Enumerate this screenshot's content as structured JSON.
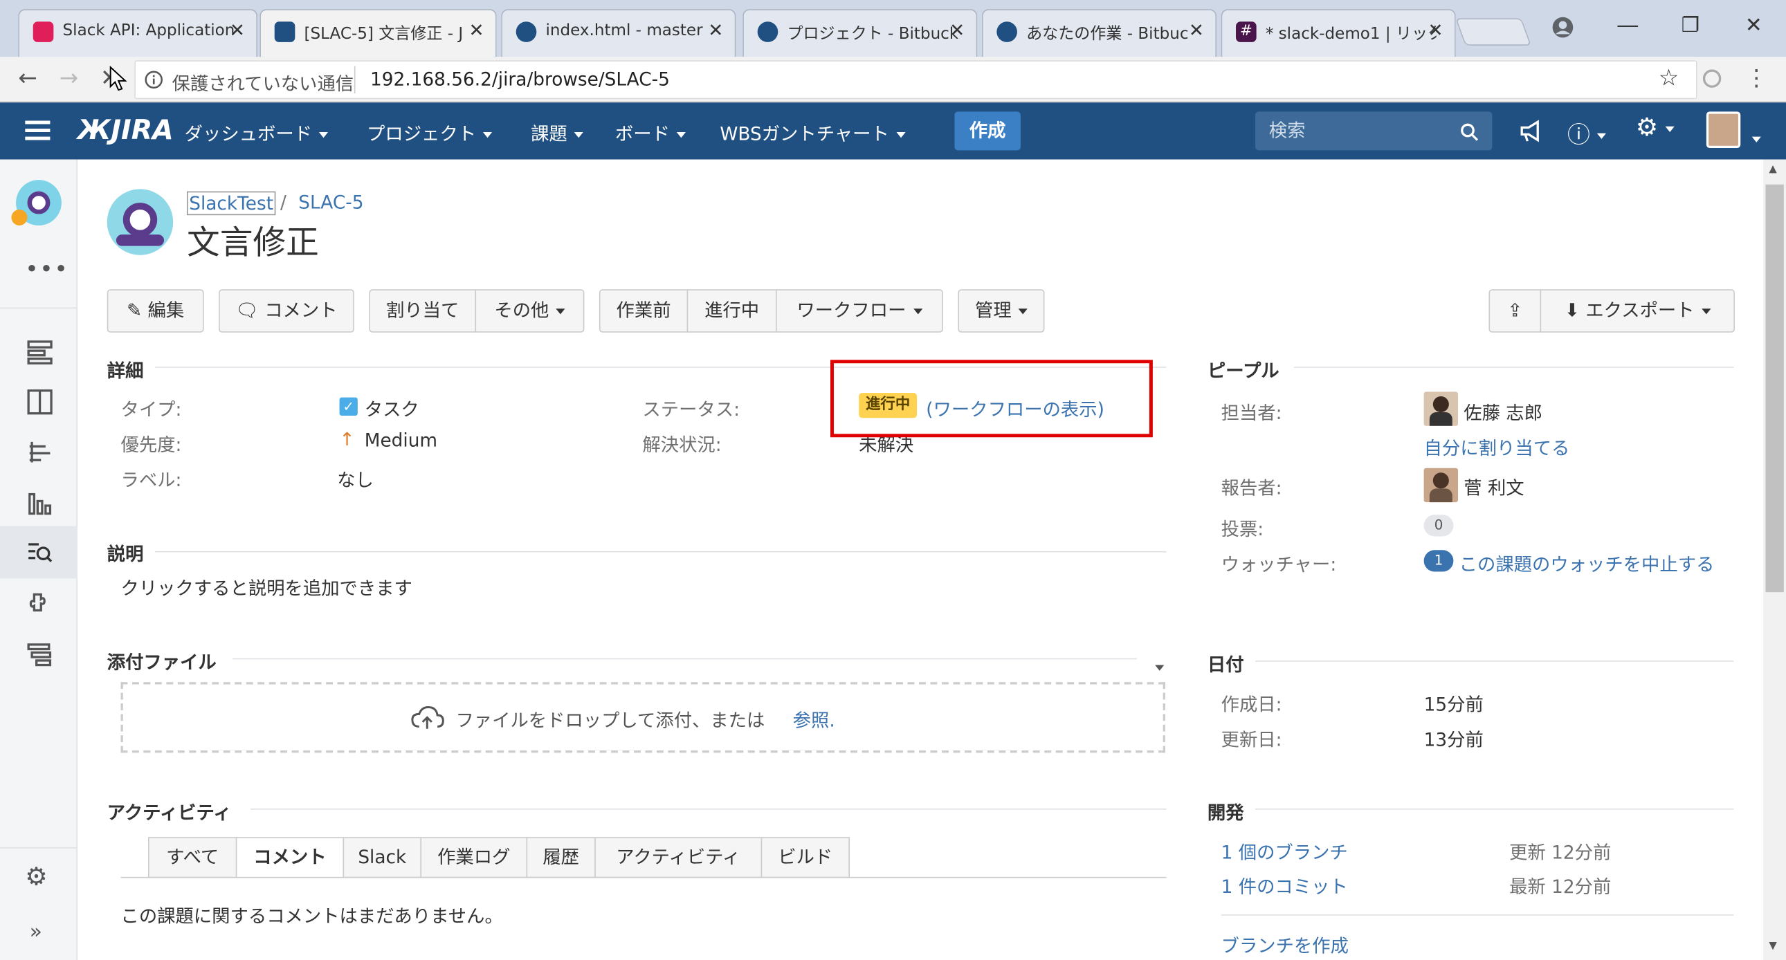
{
  "browser": {
    "tabs": [
      {
        "title": "Slack API: Application",
        "close": "✕",
        "icon_color": "#e01e5a"
      },
      {
        "title": "[SLAC-5] 文言修正 - J",
        "close": "✕",
        "icon_color": "#205081"
      },
      {
        "title": "index.html - master",
        "close": "✕",
        "icon_color": "#205081"
      },
      {
        "title": "プロジェクト - Bitbucket",
        "close": "✕",
        "icon_color": "#205081"
      },
      {
        "title": "あなたの作業 - Bitbuc",
        "close": "✕",
        "icon_color": "#205081"
      },
      {
        "title": "* slack-demo1 | リック",
        "close": "✕",
        "icon_color": "#4a154b"
      }
    ],
    "security_label": "保護されていない通信",
    "url": "192.168.56.2/jira/browse/SLAC-5"
  },
  "header": {
    "logo": "JIRA",
    "nav": [
      "ダッシュボード",
      "プロジェクト",
      "課題",
      "ボード",
      "WBSガントチャート"
    ],
    "create_label": "作成",
    "search_placeholder": "検索"
  },
  "issue": {
    "breadcrumb_project": "SlackTest",
    "breadcrumb_sep": "/",
    "breadcrumb_key": "SLAC-5",
    "title": "文言修正"
  },
  "toolbar": {
    "edit": "編集",
    "comment": "コメント",
    "assign": "割り当て",
    "more": "その他",
    "todo": "作業前",
    "in_progress": "進行中",
    "workflow": "ワークフロー",
    "admin": "管理",
    "export": "エクスポート"
  },
  "details": {
    "heading": "詳細",
    "type_label": "タイプ:",
    "type_value": "タスク",
    "priority_label": "優先度:",
    "priority_value": "Medium",
    "labels_label": "ラベル:",
    "labels_value": "なし",
    "status_label": "ステータス:",
    "status_badge": "進行中",
    "status_link": "ワークフローの表示",
    "status_paren_open": "(",
    "status_paren_close": ")",
    "resolution_label": "解決状況:",
    "resolution_value": "未解決"
  },
  "description": {
    "heading": "説明",
    "placeholder": "クリックすると説明を追加できます"
  },
  "attachments": {
    "heading": "添付ファイル",
    "drop_text": "ファイルをドロップして添付、または",
    "browse_link": "参照."
  },
  "activity": {
    "heading": "アクティビティ",
    "tabs": [
      "すべて",
      "コメント",
      "Slack",
      "作業ログ",
      "履歴",
      "アクティビティ",
      "ビルド"
    ],
    "active_tab": "コメント",
    "empty_text": "この課題に関するコメントはまだありません。"
  },
  "people": {
    "heading": "ピープル",
    "assignee_label": "担当者:",
    "assignee_name": "佐藤 志郎",
    "assign_to_me": "自分に割り当てる",
    "reporter_label": "報告者:",
    "reporter_name": "菅 利文",
    "votes_label": "投票:",
    "votes_count": "0",
    "watchers_label": "ウォッチャー:",
    "watchers_count": "1",
    "watch_stop": "この課題のウォッチを中止する"
  },
  "dates": {
    "heading": "日付",
    "created_label": "作成日:",
    "created_value": "15分前",
    "updated_label": "更新日:",
    "updated_value": "13分前"
  },
  "development": {
    "heading": "開発",
    "branches_link": "1 個のブランチ",
    "branches_time": "更新 12分前",
    "commits_link": "1 件のコミット",
    "commits_time": "最新 12分前",
    "create_branch": "ブランチを作成"
  },
  "colors": {
    "header_bg": "#205081",
    "link": "#3b73af",
    "status_badge_bg": "#ffd351",
    "highlight_box": "#e00000"
  }
}
